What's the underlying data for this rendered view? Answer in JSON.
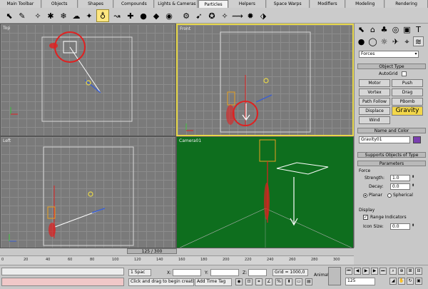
{
  "tabs": [
    "Main Toolbar",
    "Objects",
    "Shapes",
    "Compounds",
    "Lights & Cameras",
    "Particles",
    "Helpers",
    "Space Warps",
    "Modifiers",
    "Modeling",
    "Rendering"
  ],
  "viewports": {
    "top": "Top",
    "front": "Front",
    "left": "Left",
    "camera": "Camera01"
  },
  "panel": {
    "category": "Forces",
    "object_type_header": "Object Type",
    "autogrid": "AutoGrid",
    "buttons": [
      "Motor",
      "Push",
      "Vortex",
      "Drag",
      "Path Follow",
      "PBomb",
      "Displace",
      "Gravity",
      "Wind"
    ],
    "name_color_header": "Name and Color",
    "name_value": "Gravity01",
    "supports_header": "Supports Objects of Type",
    "parameters_header": "Parameters",
    "force_label": "Force",
    "strength_label": "Strength:",
    "strength_value": "1.0",
    "decay_label": "Decay:",
    "decay_value": "0.0",
    "planar_label": "Planar",
    "spherical_label": "Spherical",
    "display_label": "Display",
    "range_label": "Range Indicators",
    "icon_size_label": "Icon Size:",
    "icon_size_value": "0.0"
  },
  "scrollbar": "125 / 300",
  "ruler_ticks": [
    "0",
    "20",
    "40",
    "60",
    "80",
    "100",
    "120",
    "140",
    "160",
    "180",
    "200",
    "220",
    "240",
    "260",
    "280",
    "300"
  ],
  "status": {
    "selected": "1 Spac",
    "x_label": "X:",
    "y_label": "Y:",
    "z_label": "Z:",
    "grid": "Grid = 1000,0",
    "animate": "Animate",
    "prompt": "Click and drag to begin creati",
    "time_tag": "Add Time Tag",
    "frame": "125"
  },
  "colors": {
    "accent": "#f3d74a",
    "annotation": "#e02020",
    "camera_bg": "#0e6e1e"
  }
}
